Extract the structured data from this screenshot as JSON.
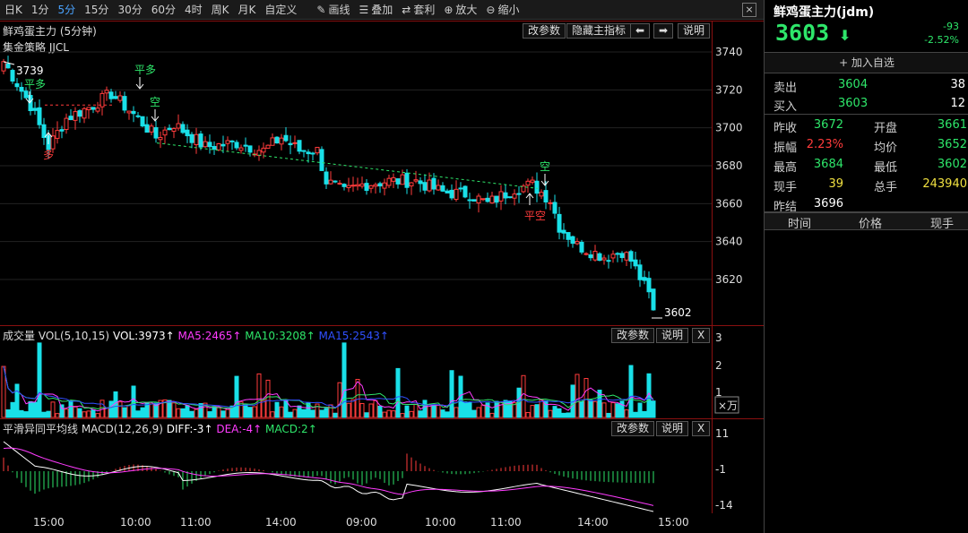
{
  "toolbar": {
    "periods": [
      "日K",
      "1分",
      "5分",
      "15分",
      "30分",
      "60分",
      "4时",
      "周K",
      "月K",
      "自定义"
    ],
    "active_period": "5分",
    "tools": [
      {
        "icon": "pencil-icon",
        "glyph": "✎",
        "label": "画线"
      },
      {
        "icon": "layers-icon",
        "glyph": "☰",
        "label": "叠加"
      },
      {
        "icon": "arbitrage-icon",
        "glyph": "⇄",
        "label": "套利"
      },
      {
        "icon": "zoom-in-icon",
        "glyph": "⊕",
        "label": "放大"
      },
      {
        "icon": "zoom-out-icon",
        "glyph": "⊖",
        "label": "缩小"
      }
    ],
    "close": "×"
  },
  "main_chart": {
    "title": "鲜鸡蛋主力 (5分钟)",
    "strategy": "集金策略 JJCL",
    "btn_params": "改参数",
    "btn_hide": "隐藏主指标",
    "btn_left": "⬅",
    "btn_right": "➡",
    "btn_help": "说明",
    "high_label": "3739",
    "low_label": "3602",
    "signals": [
      {
        "text": "平多",
        "color": "#2ee66a"
      },
      {
        "text": "多",
        "color": "#ff3b3b"
      },
      {
        "text": "平多",
        "color": "#2ee66a"
      },
      {
        "text": "空",
        "color": "#2ee66a"
      },
      {
        "text": "空",
        "color": "#2ee66a"
      },
      {
        "text": "平空",
        "color": "#ff3b3b"
      }
    ],
    "price_axis": [
      "3740",
      "3720",
      "3700",
      "3680",
      "3660",
      "3640",
      "3620"
    ]
  },
  "vol_chart": {
    "title": "成交量 VOL(5,10,15)",
    "vol": "VOL:3973↑",
    "ma5": "MA5:2465↑",
    "ma10": "MA10:3208↑",
    "ma15": "MA15:2543↑",
    "btn_params": "改参数",
    "btn_help": "说明",
    "btn_close": "X",
    "axis": [
      "3",
      "2",
      "1"
    ],
    "unit": "×万"
  },
  "macd_chart": {
    "title": "平滑异同平均线 MACD(12,26,9)",
    "diff": "DIFF:-3↑",
    "dea": "DEA:-4↑",
    "macd": "MACD:2↑",
    "btn_params": "改参数",
    "btn_help": "说明",
    "btn_close": "X",
    "axis": [
      "11",
      "-1",
      "-14"
    ]
  },
  "x_axis": [
    "15:00",
    "10:00",
    "11:00",
    "14:00",
    "09:00",
    "10:00",
    "11:00",
    "14:00",
    "15:00"
  ],
  "colors": {
    "up": "#ff3b3b",
    "down": "#19e0e8",
    "ma5": "#ff3bff",
    "ma10": "#2ee66a",
    "ma15": "#3050ff"
  },
  "quote": {
    "name": "鲜鸡蛋主力(jdm)",
    "price": "3603",
    "arrow": "⬇",
    "change": "-93",
    "change_pct": "-2.52%",
    "add_fav": "+ 加入自选",
    "sell_label": "卖出",
    "sell_price": "3604",
    "sell_vol": "38",
    "buy_label": "买入",
    "buy_price": "3603",
    "buy_vol": "12",
    "rows": [
      {
        "l1": "昨收",
        "v1": "3672",
        "l2": "开盘",
        "v2": "3661"
      },
      {
        "l1": "振幅",
        "v1": "2.23%",
        "l2": "均价",
        "v2": "3652"
      },
      {
        "l1": "最高",
        "v1": "3684",
        "l2": "最低",
        "v2": "3602"
      },
      {
        "l1": "现手",
        "v1": "39",
        "l2": "总手",
        "v2": "243940"
      },
      {
        "l1": "昨结",
        "v1": "3696",
        "l2": "",
        "v2": ""
      }
    ],
    "tick_headers": [
      "时间",
      "价格",
      "现手"
    ]
  }
}
